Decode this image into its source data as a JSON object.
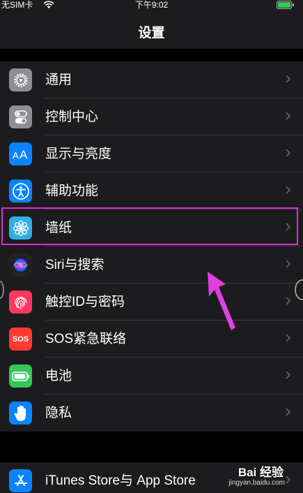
{
  "status_bar": {
    "carrier": "无SIM卡",
    "time": "下午9:02"
  },
  "nav": {
    "title": "设置"
  },
  "settings_group": [
    {
      "label": "通用"
    },
    {
      "label": "控制中心"
    },
    {
      "label": "显示与亮度"
    },
    {
      "label": "辅助功能"
    },
    {
      "label": "墙纸"
    },
    {
      "label": "Siri与搜索"
    },
    {
      "label": "触控ID与密码"
    },
    {
      "label": "SOS紧急联络",
      "icon_text": "SOS"
    },
    {
      "label": "电池"
    },
    {
      "label": "隐私"
    }
  ],
  "store_group": [
    {
      "label": "iTunes Store与 App Store"
    }
  ],
  "watermark": {
    "brand": "Bai 经验",
    "site": "jingyan.baidu.com"
  },
  "colors": {
    "background": "#000000",
    "group_background": "#1c1c1e",
    "highlight_border": "#d62fd6",
    "arrow": "#e040e0"
  },
  "icons": [
    "gear-icon",
    "toggle-switches-icon",
    "text-size-icon",
    "accessibility-icon",
    "flower-icon",
    "siri-icon",
    "fingerprint-icon",
    "sos-icon",
    "battery-icon",
    "hand-icon",
    "app-store-icon"
  ]
}
